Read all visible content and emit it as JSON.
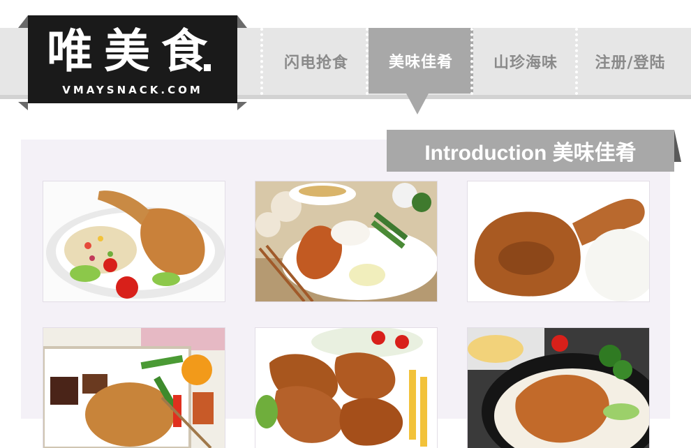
{
  "logo": {
    "title": "唯美食",
    "site": "VMAYSNACK.COM"
  },
  "nav": {
    "items": [
      {
        "label": "闪电抢食"
      },
      {
        "label": "美味佳肴"
      },
      {
        "label": "山珍海味"
      },
      {
        "label": "注册/登陆"
      }
    ],
    "active_index": 1
  },
  "section": {
    "title": "Introduction 美味佳肴"
  },
  "colors": {
    "band": "#e6e6e6",
    "active": "#a8a8a8",
    "logo_bg": "#1a1a1a",
    "panel": "#f4f1f7"
  },
  "gallery": {
    "items": [
      {
        "image": "roast-chicken-leg-with-rice-salad"
      },
      {
        "image": "roast-chicken-leg-plate-with-soup"
      },
      {
        "image": "roast-chicken-leg-closeup-with-rice"
      },
      {
        "image": "chicken-leg-bento-box"
      },
      {
        "image": "fried-chicken-drumsticks-with-fries"
      },
      {
        "image": "chicken-leg-rice-bowl"
      }
    ]
  }
}
